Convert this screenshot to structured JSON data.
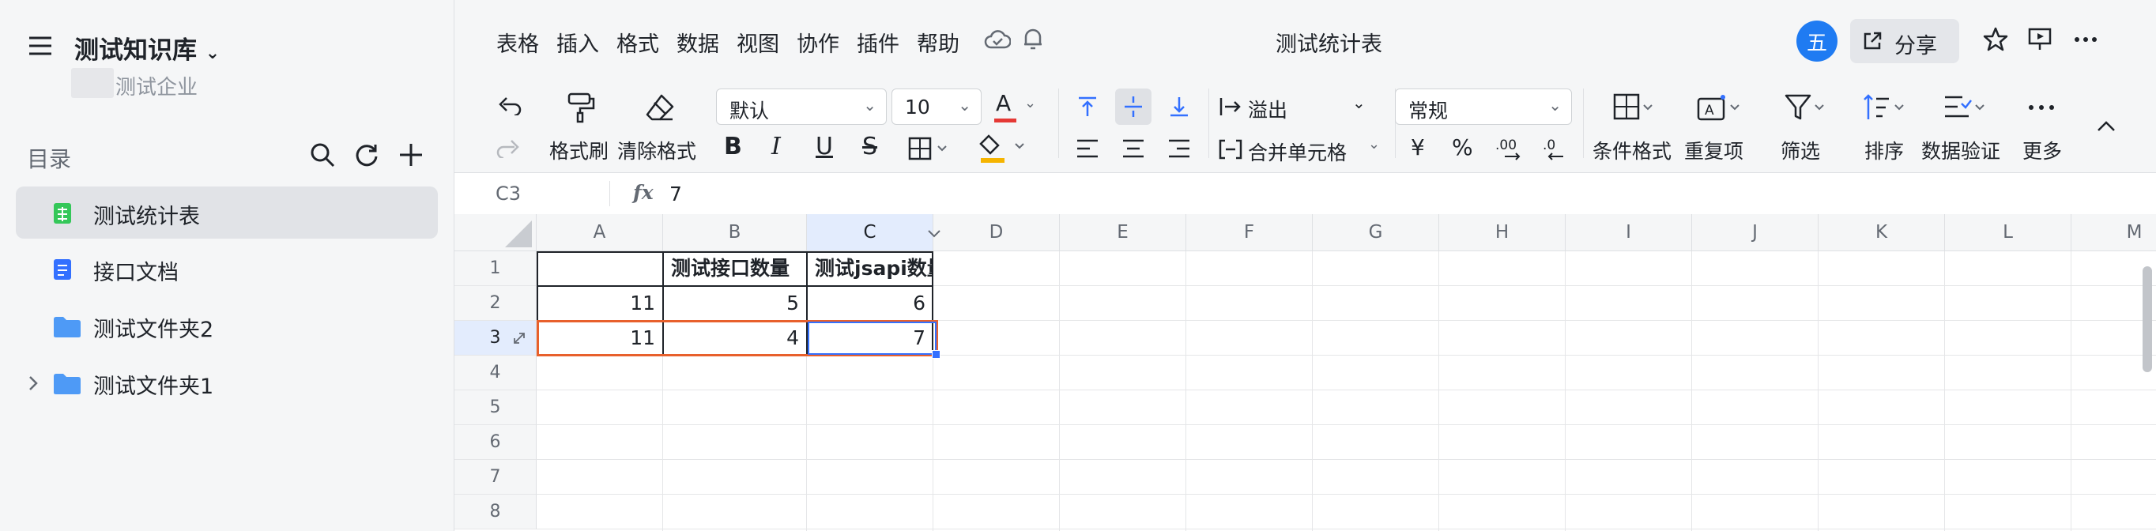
{
  "sidebar": {
    "kb_title": "测试知识库",
    "org_name": "测试企业",
    "toc_label": "目录",
    "items": [
      {
        "label": "测试统计表",
        "icon": "sheet-icon",
        "active": true
      },
      {
        "label": "接口文档",
        "icon": "doc-icon",
        "active": false
      },
      {
        "label": "测试文件夹2",
        "icon": "folder-icon",
        "active": false
      },
      {
        "label": "测试文件夹1",
        "icon": "folder-icon",
        "active": false
      }
    ]
  },
  "menu": [
    "表格",
    "插入",
    "格式",
    "数据",
    "视图",
    "协作",
    "插件",
    "帮助"
  ],
  "doc_title": "测试统计表",
  "header": {
    "avatar": "五",
    "share_label": "分享"
  },
  "toolbar": {
    "format_painter": "格式刷",
    "clear_format": "清除格式",
    "font": "默认",
    "font_size": "10",
    "overflow": "溢出",
    "merge": "合并单元格",
    "number_format": "常规",
    "currency": "¥",
    "percent": "%",
    "cond_format": "条件格式",
    "duplicates": "重复项",
    "filter": "筛选",
    "sort": "排序",
    "data_validation": "数据验证",
    "more": "更多"
  },
  "formula_bar": {
    "cell_ref": "C3",
    "fx": "fx",
    "value": "7"
  },
  "grid": {
    "columns": [
      "A",
      "B",
      "C",
      "D",
      "E",
      "F",
      "G",
      "H",
      "I",
      "J",
      "K",
      "L",
      "M"
    ],
    "rows": [
      "1",
      "2",
      "3",
      "4",
      "5",
      "6",
      "7",
      "8"
    ],
    "selected_cell": "C3",
    "cells": {
      "B1": "测试接口数量",
      "C1": "测试jsapi数量",
      "A2": "11",
      "B2": "5",
      "C2": "6",
      "A3": "11",
      "B3": "4",
      "C3": "7"
    }
  },
  "colors": {
    "accent": "#3370ff",
    "selection_outline": "#e8602c",
    "avatar_bg": "#1f7bf2",
    "folder": "#4e9af6",
    "sheet_green": "#34c759"
  }
}
